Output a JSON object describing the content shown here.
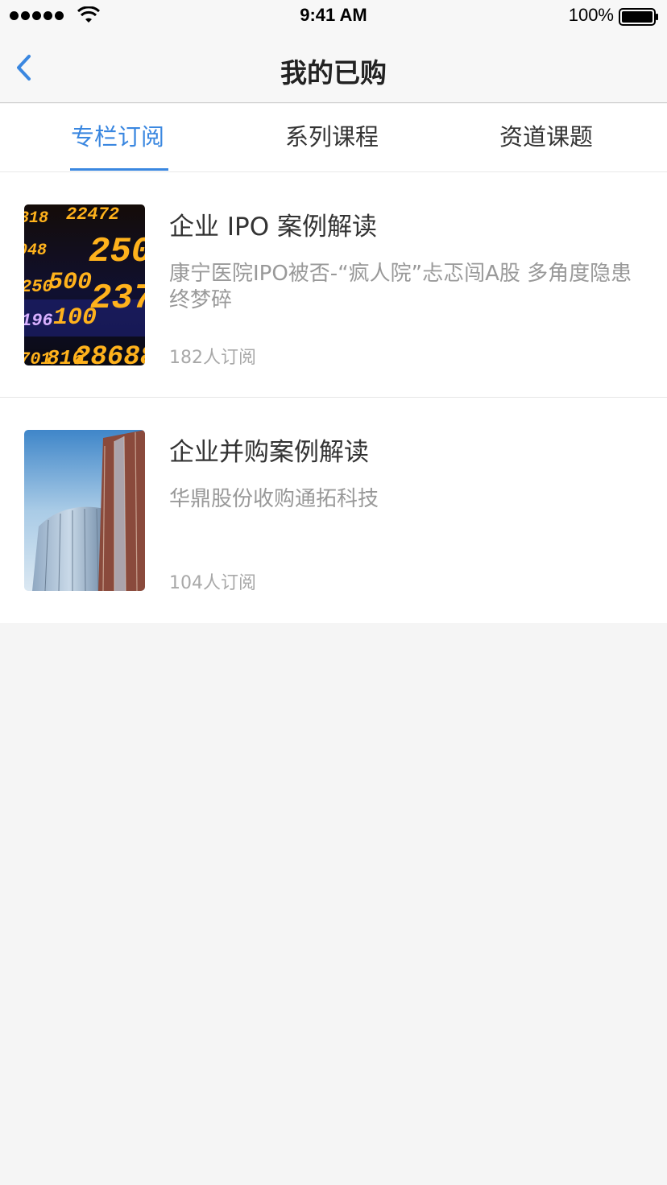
{
  "status_bar": {
    "time": "9:41 AM",
    "battery": "100%"
  },
  "nav": {
    "title": "我的已购",
    "back_icon": "chevron-left-icon",
    "accent_color": "#3a87e0"
  },
  "tabs": [
    {
      "label": "专栏订阅",
      "active": true
    },
    {
      "label": "系列课程",
      "active": false
    },
    {
      "label": "资道课题",
      "active": false
    }
  ],
  "items": [
    {
      "title": "企业 IPO 案例解读",
      "description": "康宁医院IPO被否-“疯人院”忐忑闯A股  多角度隐患终梦碎",
      "subscribers": "182人订阅",
      "thumbnail": "stock-ticker-image"
    },
    {
      "title": "企业并购案例解读",
      "description": "华鼎股份收购通拓科技",
      "subscribers": "104人订阅",
      "thumbnail": "skyscraper-image"
    }
  ]
}
